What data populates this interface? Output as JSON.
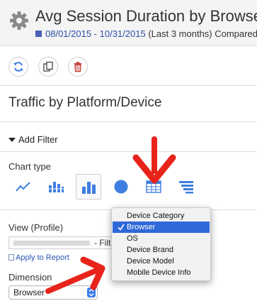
{
  "header": {
    "title": "Avg Session Duration by Browser",
    "date_range": "08/01/2015 - 10/31/2015",
    "date_suffix": "(Last 3 months) Compared"
  },
  "toolbar": {
    "refresh_icon": "refresh-icon",
    "copy_icon": "copy-icon",
    "delete_icon": "trash-icon"
  },
  "section_title": "Traffic by Platform/Device",
  "add_filter_label": "Add Filter",
  "chart_type": {
    "label": "Chart type",
    "options": [
      "line-chart-icon",
      "bar-line-icon",
      "bar-chart-icon",
      "pie-chart-icon",
      "table-icon",
      "list-icon"
    ],
    "selected": "bar-chart-icon"
  },
  "view": {
    "label": "View (Profile)",
    "filter_text": "- Filte"
  },
  "apply_label": "Apply to Report",
  "dimension": {
    "label": "Dimension",
    "value": "Browser"
  },
  "dropdown": {
    "options": [
      "Device Category",
      "Browser",
      "OS",
      "Device Brand",
      "Device Model",
      "Mobile Device Info"
    ],
    "selected": "Browser"
  },
  "colors": {
    "accent": "#2f68d8",
    "arrow": "#e8231a",
    "delete": "#c0392b",
    "icons": "#3d7ee0"
  }
}
